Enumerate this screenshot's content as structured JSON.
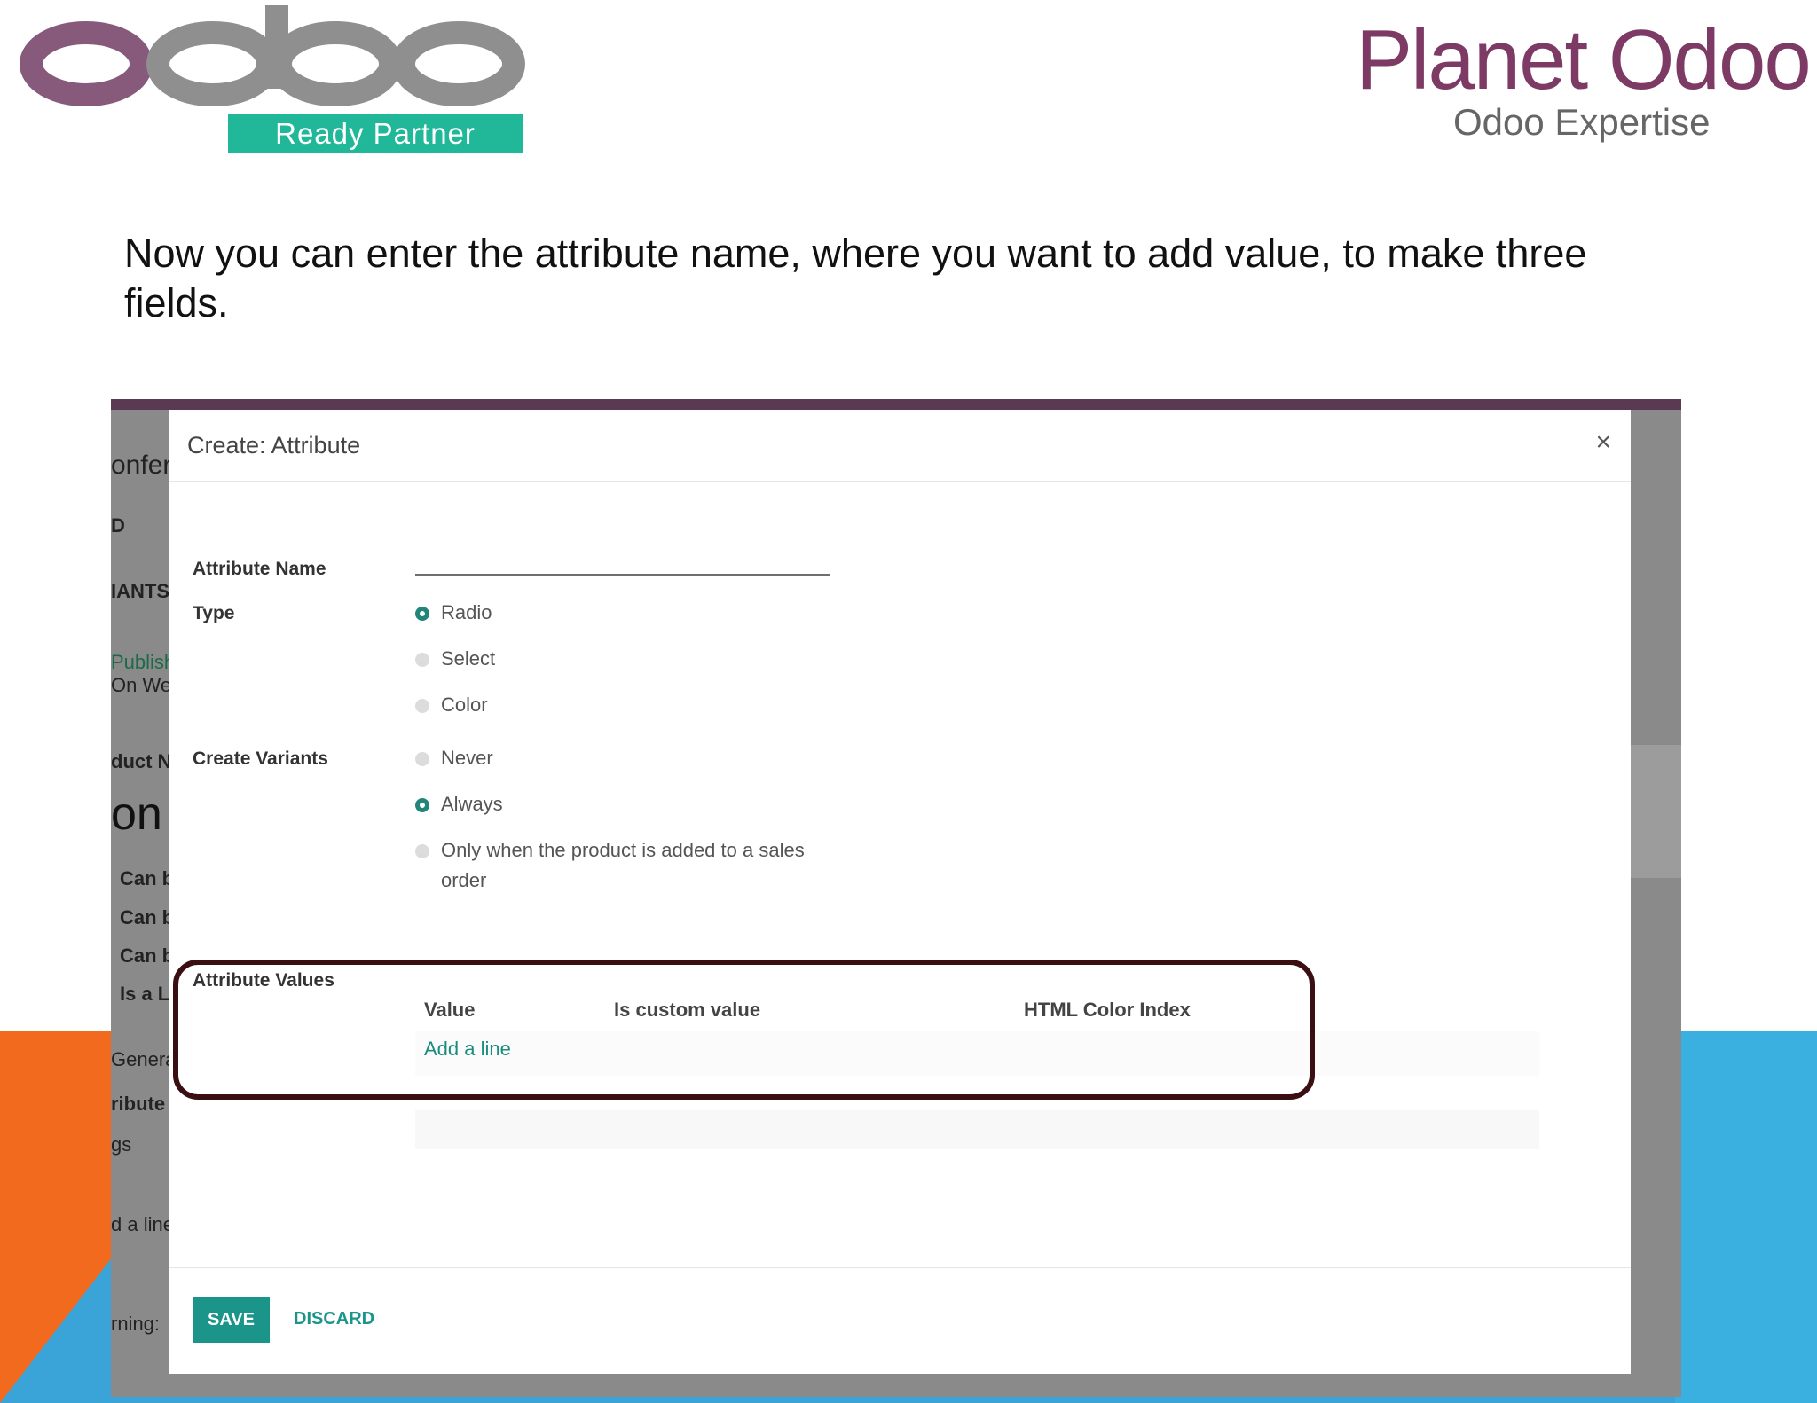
{
  "logos": {
    "odoo_wordmark": "odoo",
    "ready_partner": "Ready Partner",
    "planet_odoo_part1": "Planet ",
    "planet_odoo_part2": "Odoo",
    "odoo_expertise": "Odoo Expertise"
  },
  "caption": "Now you can enter the attribute name, where you want to add value, to make three fields.",
  "background_fragments": {
    "f1": "onfer",
    "f2": "D",
    "f3": "IANTS",
    "f4": "Publish",
    "f5": "On Wel",
    "f6": "duct N",
    "f7": "on",
    "f8": "Can b",
    "f9": "Can b",
    "f10": "Can b",
    "f11": "Is a L",
    "f12": "General",
    "f13": "ribute",
    "f14": "gs",
    "f15": "d a line",
    "f16": "rning:"
  },
  "dialog": {
    "title": "Create: Attribute",
    "close": "×",
    "fields": {
      "attribute_name_label": "Attribute Name",
      "attribute_name_value": "",
      "type_label": "Type",
      "type_options": [
        "Radio",
        "Select",
        "Color"
      ],
      "type_selected": "Radio",
      "create_variants_label": "Create Variants",
      "create_variants_options": [
        "Never",
        "Always",
        "Only when the product is added to a sales order"
      ],
      "create_variants_selected": "Always",
      "attribute_values_label": "Attribute Values"
    },
    "table": {
      "columns": [
        "Value",
        "Is custom value",
        "HTML Color Index"
      ],
      "add_line": "Add a line"
    },
    "buttons": {
      "save": "SAVE",
      "discard": "DISCARD"
    }
  },
  "colors": {
    "accent_teal": "#1b948a",
    "odoo_purple": "#875a7b",
    "ready_green": "#21b799",
    "highlight": "#3b0e12",
    "orange": "#f26a1e",
    "blue": "#39b0e0"
  }
}
